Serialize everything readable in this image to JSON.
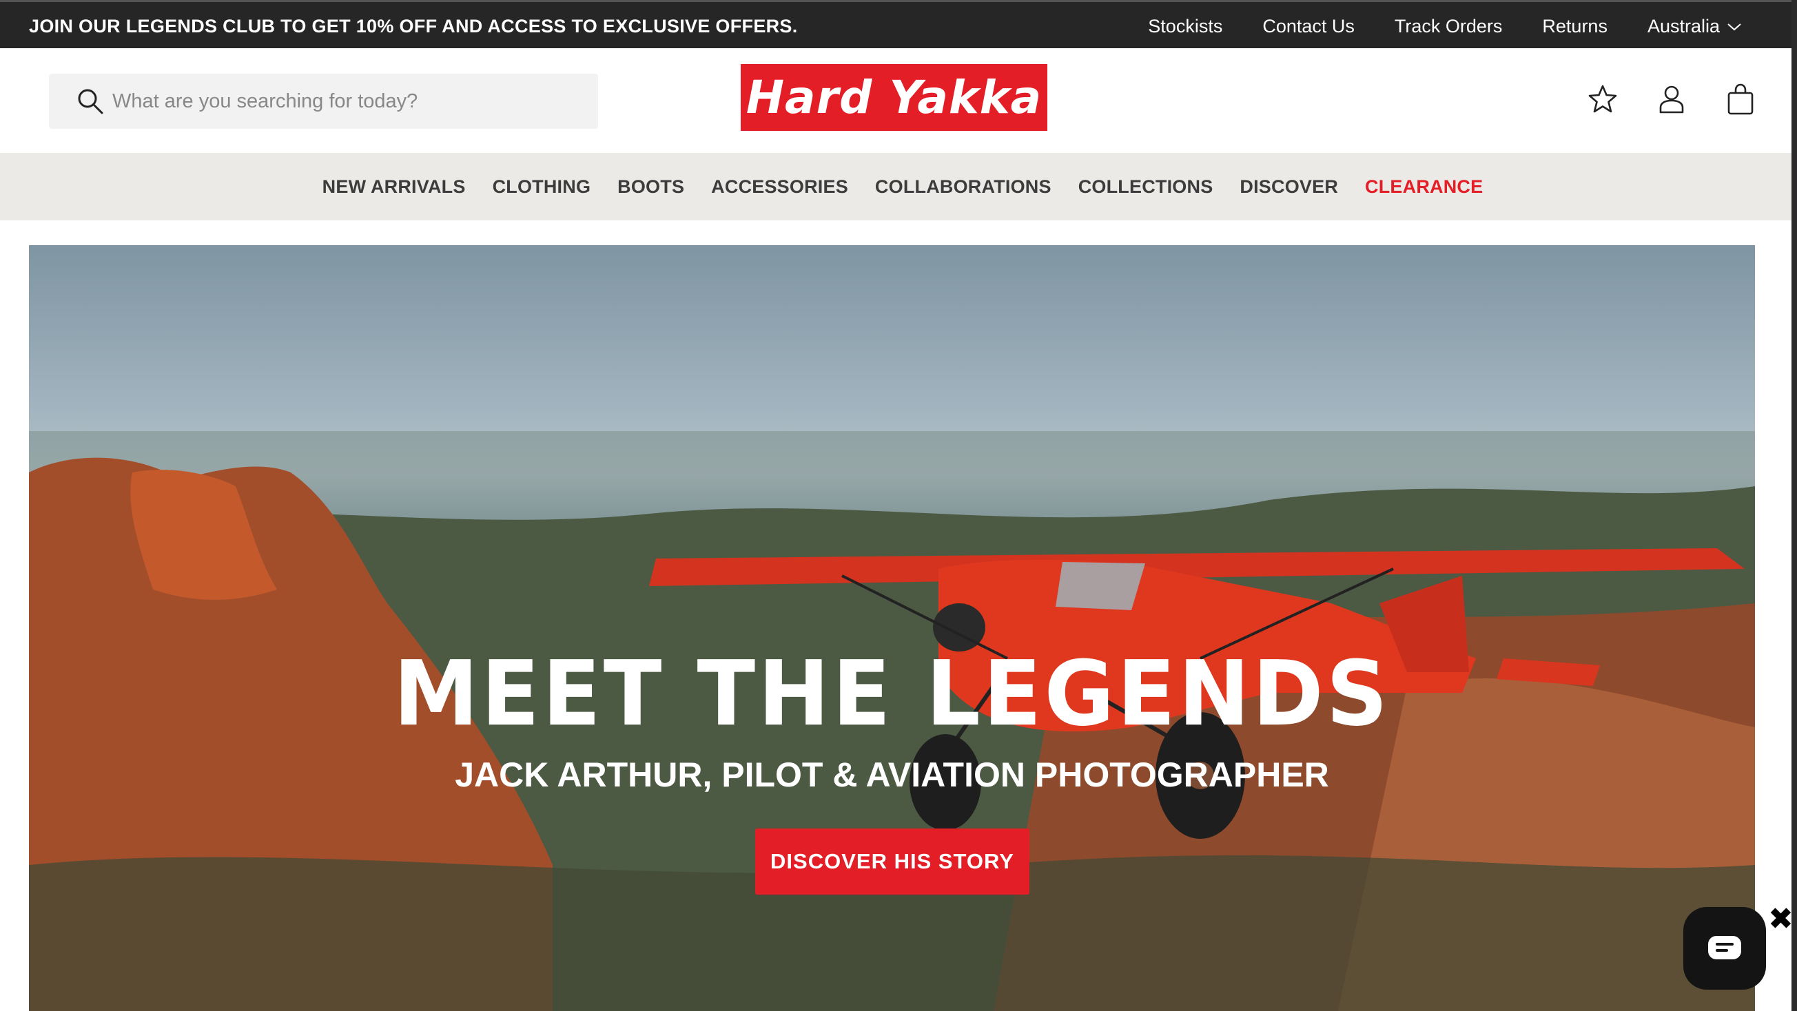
{
  "announcement": {
    "promo": "JOIN OUR LEGENDS CLUB TO GET 10% OFF AND ACCESS TO EXCLUSIVE OFFERS.",
    "links": [
      "Stockists",
      "Contact Us",
      "Track Orders",
      "Returns"
    ],
    "country": "Australia"
  },
  "header": {
    "search_placeholder": "What are you searching for today?",
    "logo_text": "Hard Yakka",
    "icons": [
      "star-icon",
      "user-icon",
      "bag-icon"
    ]
  },
  "nav": {
    "items": [
      "NEW ARRIVALS",
      "CLOTHING",
      "BOOTS",
      "ACCESSORIES",
      "COLLABORATIONS",
      "COLLECTIONS",
      "DISCOVER"
    ],
    "clearance": "CLEARANCE"
  },
  "hero": {
    "title": "MEET THE LEGENDS",
    "subtitle": "JACK ARTHUR, PILOT & AVIATION PHOTOGRAPHER",
    "cta": "DISCOVER HIS STORY"
  },
  "colors": {
    "brand_red": "#e41e26",
    "topbar_bg": "#262626",
    "nav_bg": "#ebeae6"
  }
}
